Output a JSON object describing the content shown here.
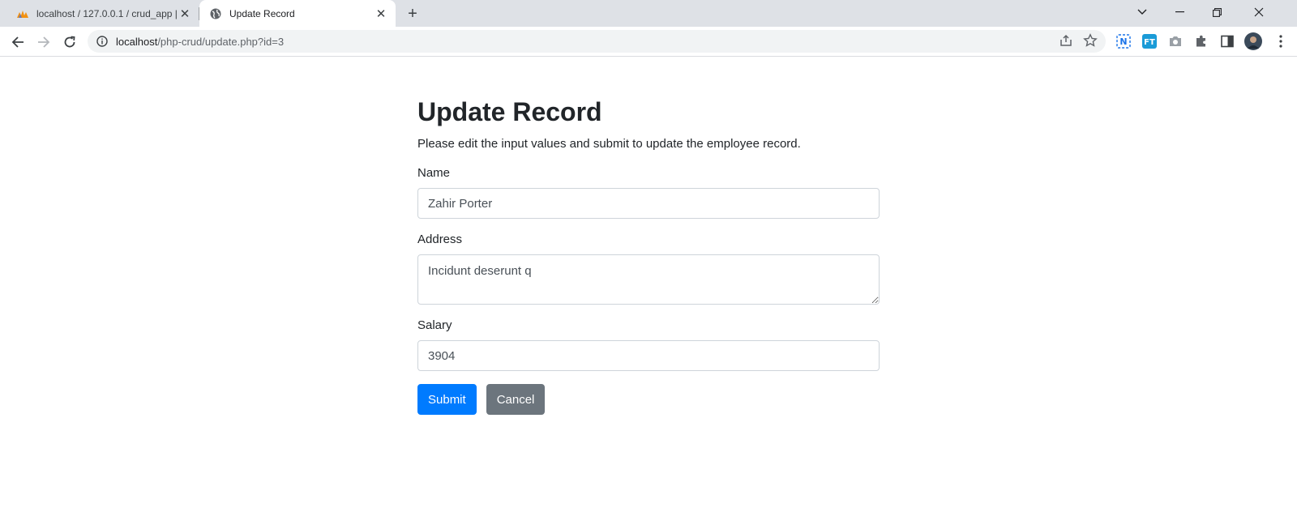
{
  "browser": {
    "tabs": [
      {
        "title": "localhost / 127.0.0.1 / crud_app |",
        "active": false,
        "icon": "phpmyadmin-icon"
      },
      {
        "title": "Update Record",
        "active": true,
        "icon": "globe-icon"
      }
    ],
    "url_host": "localhost",
    "url_path": "/php-crud/update.php?id=3",
    "colors": {
      "tabstrip": "#dee1e6",
      "omnibox": "#f1f3f4"
    }
  },
  "page": {
    "title": "Update Record",
    "description": "Please edit the input values and submit to update the employee record.",
    "form": {
      "name_label": "Name",
      "name_value": "Zahir Porter",
      "address_label": "Address",
      "address_value": "Incidunt deserunt q",
      "salary_label": "Salary",
      "salary_value": "3904",
      "submit_label": "Submit",
      "cancel_label": "Cancel"
    },
    "colors": {
      "primary": "#007bff",
      "secondary": "#6c757d"
    }
  }
}
